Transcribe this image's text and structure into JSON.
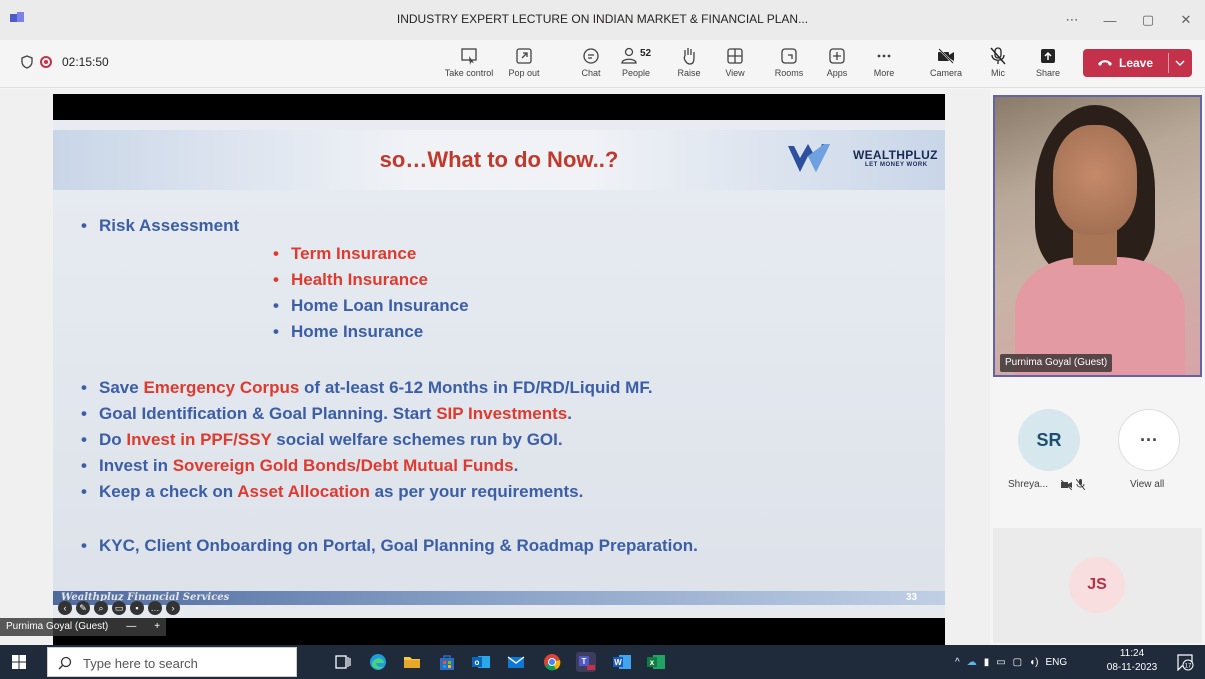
{
  "window": {
    "title": "INDUSTRY EXPERT LECTURE ON INDIAN MARKET & FINANCIAL PLAN...",
    "controls": [
      "⋯",
      "—",
      "▢",
      "✕"
    ]
  },
  "meeting": {
    "timer": "02:15:50",
    "toolbar": [
      {
        "label": "Take control",
        "icon": "take-control-icon"
      },
      {
        "label": "Pop out",
        "icon": "pop-out-icon"
      },
      {
        "label": "Chat",
        "icon": "chat-icon"
      },
      {
        "label": "People",
        "icon": "people-icon",
        "count": "52"
      },
      {
        "label": "Raise",
        "icon": "raise-hand-icon"
      },
      {
        "label": "View",
        "icon": "view-icon"
      },
      {
        "label": "Rooms",
        "icon": "rooms-icon"
      },
      {
        "label": "Apps",
        "icon": "apps-icon"
      },
      {
        "label": "More",
        "icon": "more-icon"
      },
      {
        "label": "Camera",
        "icon": "camera-off-icon"
      },
      {
        "label": "Mic",
        "icon": "mic-off-icon"
      },
      {
        "label": "Share",
        "icon": "share-icon"
      }
    ],
    "leave_label": "Leave",
    "leave_color": "#c4314b"
  },
  "slide": {
    "title": "so…What to do Now..?",
    "logo_text": "WEALTHPLUZ",
    "logo_sub": "LET MONEY WORK",
    "risk_heading": "Risk Assessment",
    "sub_items": [
      {
        "text": "Term Insurance",
        "color": "red"
      },
      {
        "text": "Health Insurance",
        "color": "red"
      },
      {
        "text": "Home Loan Insurance",
        "color": "blue"
      },
      {
        "text": "Home Insurance",
        "color": "blue"
      }
    ],
    "bullets": [
      {
        "pre": "Save ",
        "hl": "Emergency Corpus",
        "post": " of at-least 6-12 Months in FD/RD/Liquid MF."
      },
      {
        "pre": "Goal Identification & Goal Planning. Start ",
        "hl": "SIP Investments",
        "post": "."
      },
      {
        "pre": "Do ",
        "hl": "Invest in PPF/SSY",
        "post": " social welfare schemes run by GOI."
      },
      {
        "pre": "Invest in ",
        "hl": "Sovereign Gold Bonds/Debt Mutual Funds",
        "post": "."
      },
      {
        "pre": "Keep a check on ",
        "hl": "Asset Allocation",
        "post": " as per your requirements."
      }
    ],
    "last_bullet": "KYC, Client Onboarding on Portal, Goal Planning & Roadmap Preparation.",
    "footer_brand": "Wealthpluz Financial Services",
    "page_number": "33",
    "accent_red": "#e03a2f",
    "accent_blue": "#3b5ea6"
  },
  "presenter": {
    "name": "Purnima Goyal (Guest)",
    "zoom_out": "—",
    "zoom_in": "+"
  },
  "participants": {
    "video_name": "Purnima Goyal (Guest)",
    "sr_initials": "SR",
    "sr_name": "Shreya...",
    "view_all": "View all",
    "more_glyph": "···",
    "js_initials": "JS"
  },
  "taskbar": {
    "search_placeholder": "Type here to search",
    "lang": "ENG",
    "time": "11:24",
    "date": "08-11-2023",
    "notif_count": "17"
  }
}
